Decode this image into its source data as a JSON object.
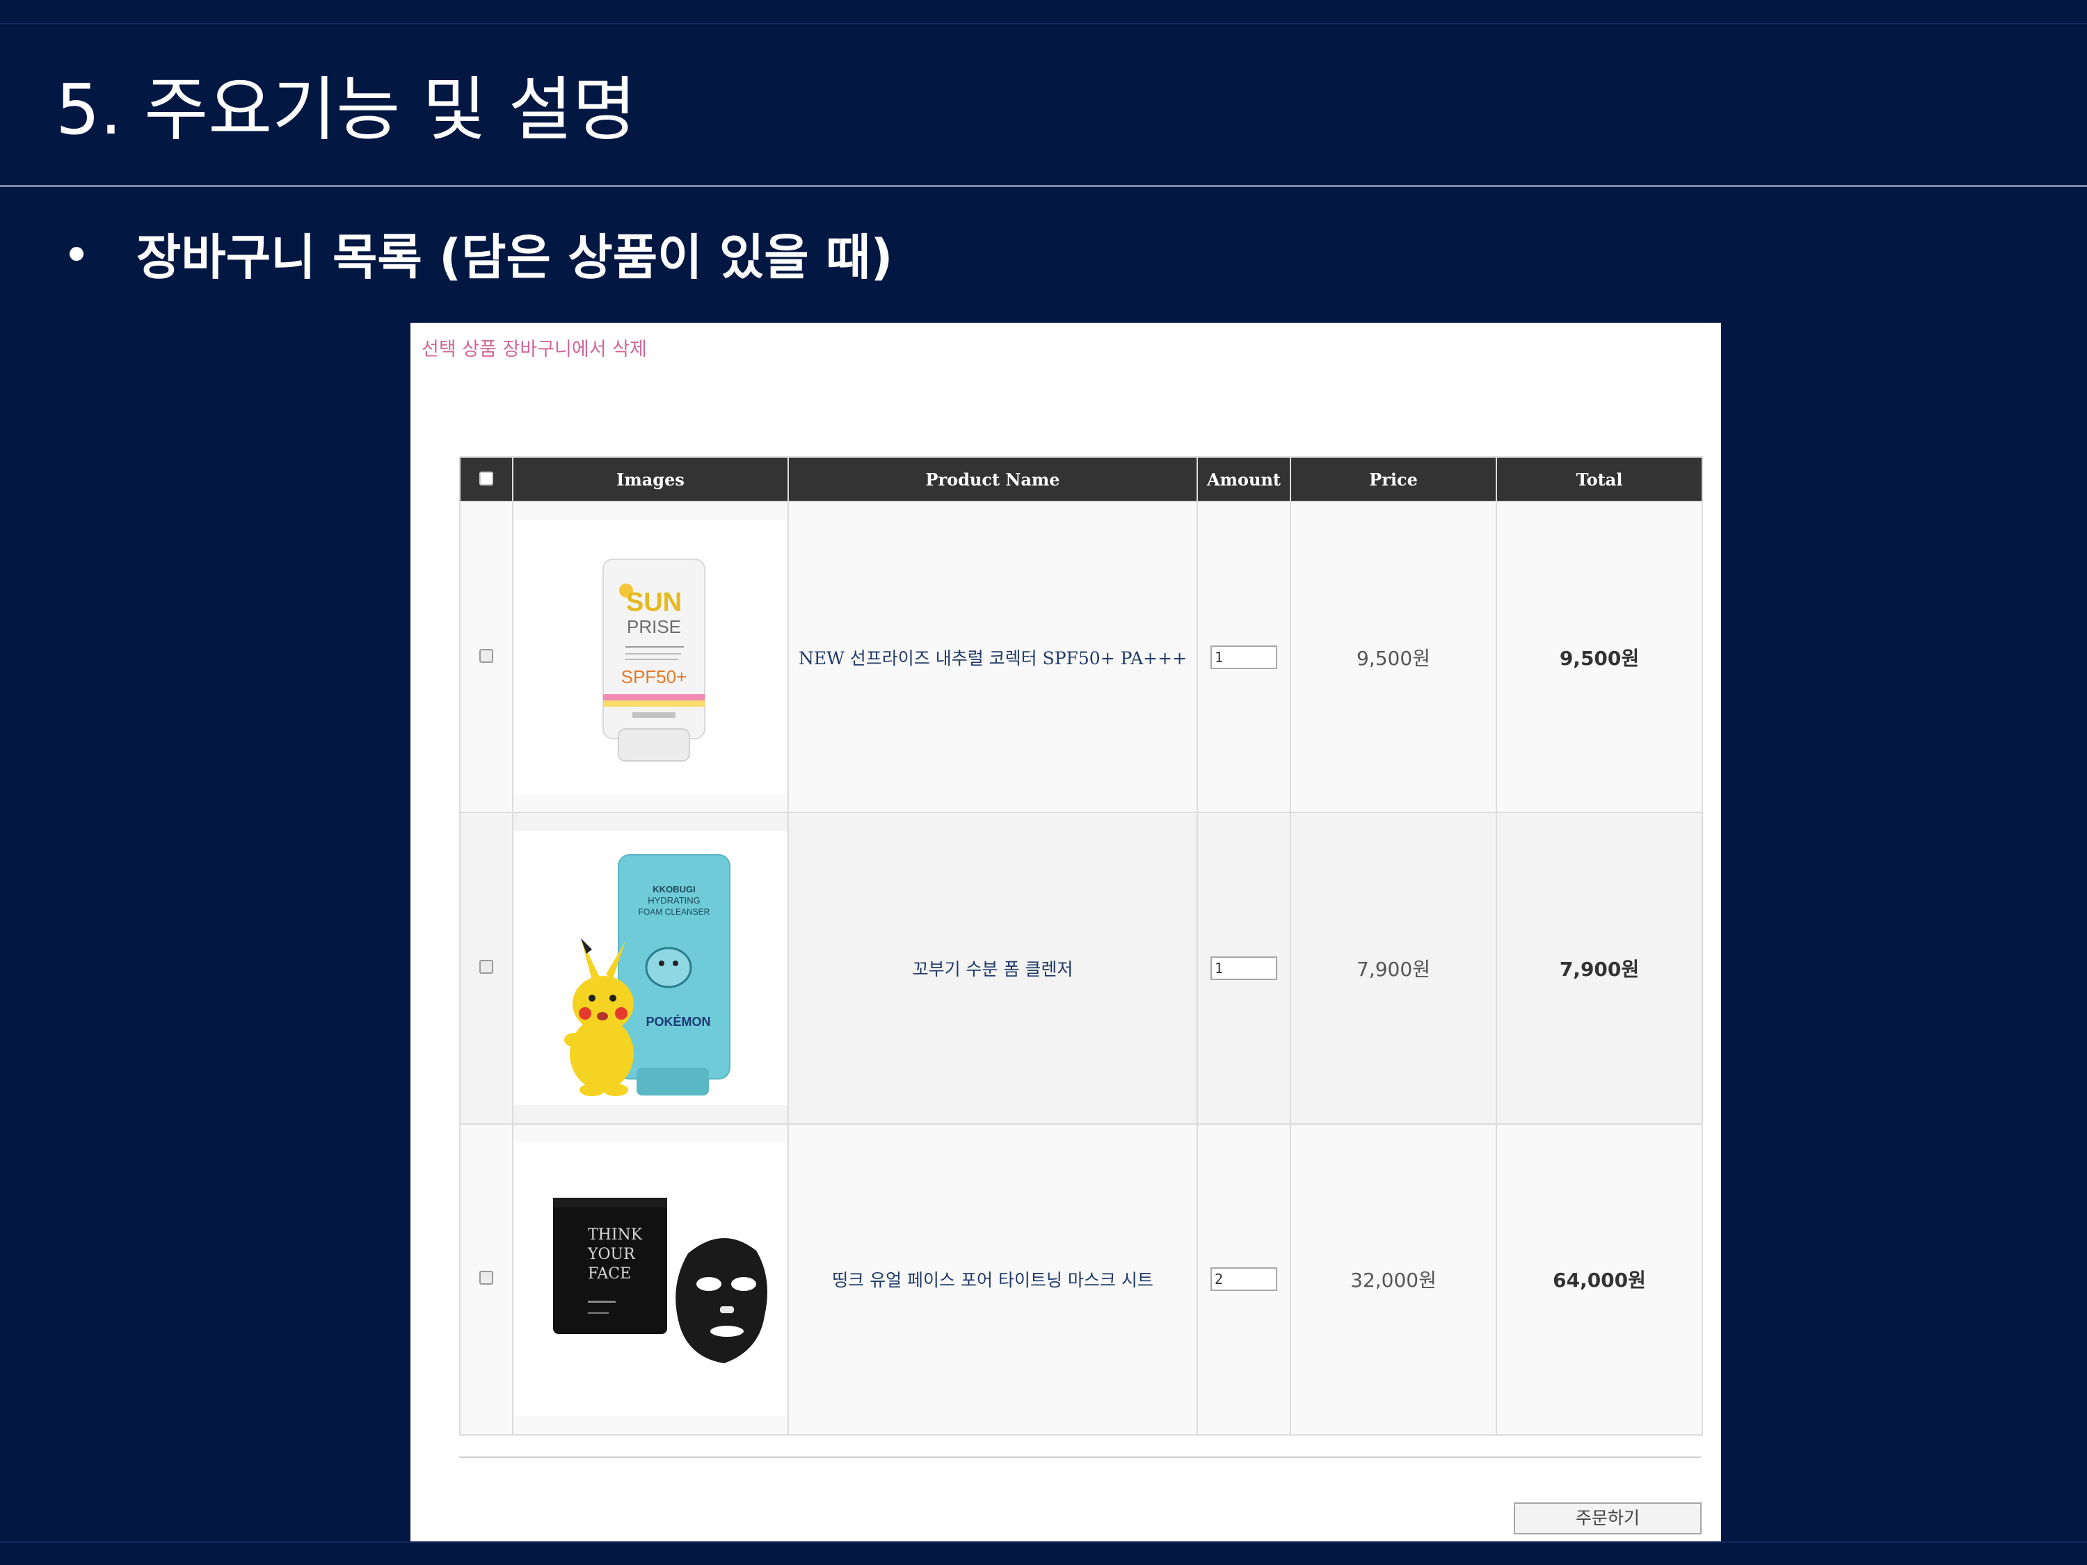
{
  "slide": {
    "title": "5. 주요기능 및 설명",
    "bullet": "장바구니 목록 (담은 상품이 있을 때)"
  },
  "cart": {
    "delete_selected_link": "선택 상품 장바구니에서 삭제",
    "columns": {
      "images": "Images",
      "product_name": "Product Name",
      "amount": "Amount",
      "price": "Price",
      "total": "Total"
    },
    "items": [
      {
        "image": "sunscreen-tube-image",
        "image_text": [
          "SUN",
          "PRISE",
          "SPF50+"
        ],
        "name": "NEW 선프라이즈 내추럴 코렉터 SPF50+ PA+++",
        "amount": "1",
        "price": "9,500원",
        "total": "9,500원",
        "checked": false
      },
      {
        "image": "foam-cleanser-pokemon-image",
        "image_text": [
          "KKOBUGI",
          "HYDRATING",
          "FOAM CLEANSER",
          "POKÉMON"
        ],
        "name": "꼬부기 수분 폼 클렌저",
        "amount": "1",
        "price": "7,900원",
        "total": "7,900원",
        "checked": false
      },
      {
        "image": "black-mask-sheet-image",
        "image_text": [
          "THINK",
          "YOUR",
          "FACE"
        ],
        "name": "띵크 유얼 페이스 포어 타이트닝 마스크 시트",
        "amount": "2",
        "price": "32,000원",
        "total": "64,000원",
        "checked": false
      }
    ],
    "order_button": "주문하기"
  },
  "colors": {
    "slide_background": "#021742",
    "table_header": "#333333",
    "delete_link": "#d0699a",
    "product_link": "#1f3a68"
  }
}
